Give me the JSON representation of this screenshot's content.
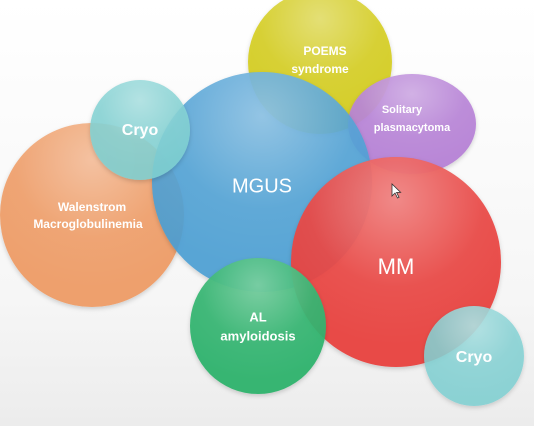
{
  "diagram": {
    "bubbles": [
      {
        "id": "walenstrom",
        "lines": [
          "Walenstrom",
          "Macroglobulinemia"
        ],
        "color": "#ef9b64"
      },
      {
        "id": "mgus",
        "lines": [
          "MGUS"
        ],
        "color": "#4a9fd4"
      },
      {
        "id": "cryo_top",
        "lines": [
          "Cryo"
        ],
        "color": "#7fd0d2"
      },
      {
        "id": "poems",
        "lines": [
          "POEMS",
          "syndrome"
        ],
        "color": "#d4cc1f"
      },
      {
        "id": "solitary",
        "lines": [
          "Solitary",
          "plasmacytoma"
        ],
        "color": "#b57fd6"
      },
      {
        "id": "mm",
        "lines": [
          "MM"
        ],
        "color": "#e8403c"
      },
      {
        "id": "al",
        "lines": [
          "AL",
          "amyloidosis"
        ],
        "color": "#2db36a"
      },
      {
        "id": "cryo_bottom",
        "lines": [
          "Cryo"
        ],
        "color": "#7fd0d2"
      }
    ]
  }
}
